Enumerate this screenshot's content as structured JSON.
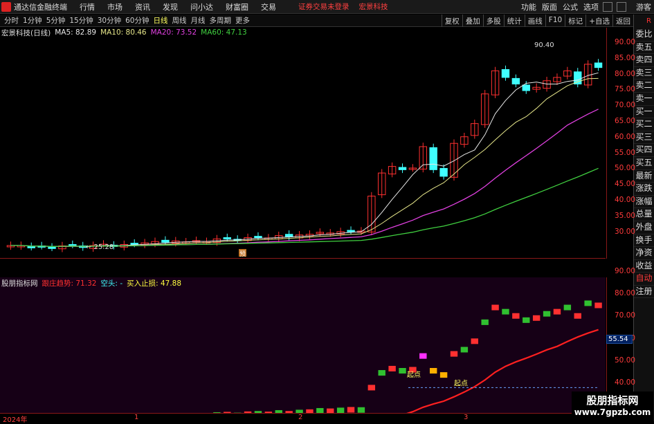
{
  "menubar": {
    "app_title": "通达信金融终端",
    "menus": [
      "行情",
      "市场",
      "资讯",
      "发现",
      "问小达",
      "财富圈",
      "交易"
    ],
    "notice": "证券交易未登录",
    "notice_stock": "宏景科技",
    "right_menus": [
      "功能",
      "版面",
      "公式",
      "选项",
      "游客"
    ]
  },
  "periodbar": {
    "periods": [
      "分时",
      "1分钟",
      "5分钟",
      "15分钟",
      "30分钟",
      "60分钟",
      "日线",
      "周线",
      "月线",
      "多周期",
      "更多"
    ],
    "active_period": "日线",
    "tools": [
      "复权",
      "叠加",
      "多股",
      "统计",
      "画线",
      "F10",
      "标记",
      "+自选",
      "返回"
    ]
  },
  "sidepanel": {
    "corner": "R",
    "items": [
      "委比",
      "卖五",
      "卖四",
      "卖三",
      "卖二",
      "卖一",
      "买一",
      "买二",
      "买三",
      "买四",
      "买五",
      "最新",
      "涨跌",
      "涨幅",
      "总量",
      "外盘",
      "换手",
      "净资",
      "收益",
      "自动",
      "注册"
    ]
  },
  "main_chart": {
    "stock_label": "宏景科技(日线)",
    "ma5": "MA5: 82.89",
    "ma10": "MA10: 80.46",
    "ma20": "MA20: 73.52",
    "ma60": "MA60: 47.13",
    "high_mark": "90.40",
    "low_mark": "25.28",
    "event_tag": "预",
    "colors": {
      "up": "#ff3030",
      "down": "#40ffff",
      "ma5": "#e8e8e8",
      "ma10": "#e6e68a",
      "ma20": "#e040e0",
      "ma60": "#40d040"
    }
  },
  "sub_chart": {
    "indicator_name": "股朋指标网",
    "line1": "跟庄趋势: 71.32",
    "line2": "空头: -",
    "line3": "买入止损: 47.88",
    "last_value": "55.54",
    "marker1": "起点",
    "marker2": "起点"
  },
  "axes": {
    "main_ticks": [
      "90.00",
      "85.00",
      "80.00",
      "75.00",
      "70.00",
      "65.00",
      "60.00",
      "55.00",
      "50.00",
      "45.00",
      "40.00",
      "35.00",
      "30.00"
    ],
    "sub_ticks": [
      "90.00",
      "80.00",
      "70.00",
      "60.00",
      "50.00",
      "40.00"
    ]
  },
  "dates": {
    "year": "2024年",
    "m1": "1",
    "m2": "2",
    "m3": "3"
  },
  "watermark": {
    "line1": "股朋指标网",
    "line2": "www.7gpzb.com"
  }
}
